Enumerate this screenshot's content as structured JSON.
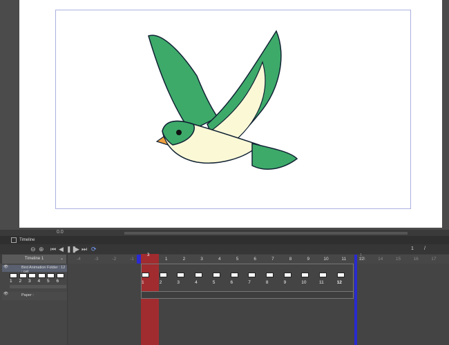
{
  "window": {
    "panel_title": "Timeline",
    "status_zoom": "0.0",
    "page_indicator": "1",
    "page_sep": "/"
  },
  "timeline": {
    "name": "Timeline 1",
    "current_frame": "3",
    "end_marker": "1",
    "ruler_before": [
      "-4",
      "-3",
      "-2",
      "-1"
    ],
    "ruler_in": [
      "1",
      "2",
      "3",
      "4",
      "5",
      "6",
      "7",
      "8",
      "9",
      "10",
      "11",
      "12"
    ],
    "ruler_after": [
      "13",
      "14",
      "15",
      "16",
      "17"
    ]
  },
  "layers": [
    {
      "name": "Bird Animation Folder : 12 : cel",
      "cells": [
        "1",
        "2",
        "3",
        "4",
        "5",
        "6"
      ]
    },
    {
      "name": "Paper :"
    }
  ],
  "track_cells": [
    "1",
    "2",
    "3",
    "4",
    "5",
    "6",
    "7",
    "8",
    "9",
    "10",
    "11",
    "12"
  ],
  "colors": {
    "playhead": "#b0282c",
    "bird_green": "#3daa6a",
    "bird_cream": "#fbf8d6",
    "beak": "#f0a040"
  }
}
